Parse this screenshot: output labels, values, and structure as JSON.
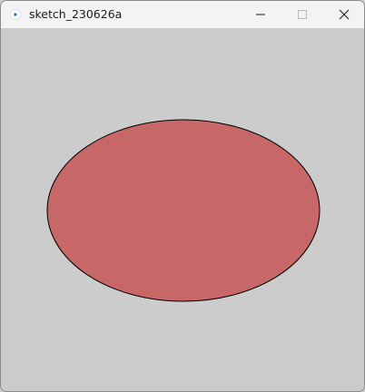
{
  "window": {
    "title": "sketch_230626a",
    "icon": "processing-play-icon",
    "controls": {
      "minimize_icon": "minimize-icon",
      "maximize_icon": "maximize-icon",
      "close_icon": "close-icon"
    }
  },
  "sketch": {
    "background_color": "#cccccc",
    "ellipse": {
      "shape": "ellipse",
      "fill_color": "#c86767",
      "stroke_color": "#000000"
    }
  }
}
